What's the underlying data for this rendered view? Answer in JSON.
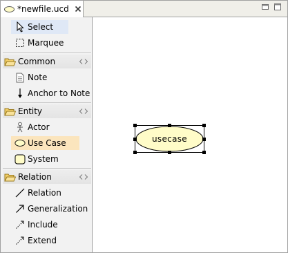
{
  "editor_tab": {
    "title": "*newfile.ucd",
    "icon": "usecase-file-icon"
  },
  "palette": {
    "tools": [
      {
        "label": "Select",
        "icon": "arrow-pointer-icon",
        "selected": true
      },
      {
        "label": "Marquee",
        "icon": "marquee-icon",
        "selected": false
      }
    ],
    "drawers": [
      {
        "label": "Common",
        "icon": "folder-open-icon",
        "items": [
          {
            "label": "Note",
            "icon": "note-icon"
          },
          {
            "label": "Anchor to Note",
            "icon": "anchor-arrow-icon"
          }
        ]
      },
      {
        "label": "Entity",
        "icon": "folder-open-icon",
        "items": [
          {
            "label": "Actor",
            "icon": "actor-icon"
          },
          {
            "label": "Use Case",
            "icon": "usecase-icon",
            "active": true
          },
          {
            "label": "System",
            "icon": "system-icon"
          }
        ]
      },
      {
        "label": "Relation",
        "icon": "folder-open-icon",
        "items": [
          {
            "label": "Relation",
            "icon": "line-icon"
          },
          {
            "label": "Generalization",
            "icon": "generalization-arrow-icon"
          },
          {
            "label": "Include",
            "icon": "dashed-arrow-icon"
          },
          {
            "label": "Extend",
            "icon": "dashed-arrow-icon"
          }
        ]
      }
    ]
  },
  "canvas": {
    "nodes": [
      {
        "type": "usecase",
        "label": "usecase",
        "selected": true
      }
    ]
  },
  "colors": {
    "usecase_fill": "#fffcc8",
    "selected_tool_bg": "#dfe8f6",
    "active_tool_bg": "#fbe5bd",
    "folder_yellow": "#f3cf6a"
  }
}
